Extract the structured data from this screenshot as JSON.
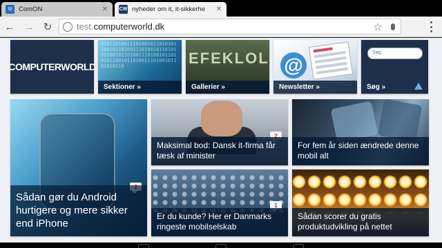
{
  "tabs": [
    {
      "label": "ComON",
      "favicon": "U"
    },
    {
      "label": "nyheder om it, it-sikkerhe",
      "favicon": "CW"
    }
  ],
  "toolbar": {
    "url_scheme": "test.",
    "url_host": "computerworld.dk"
  },
  "nav_tiles": {
    "logo_text": "COMPUTERWORLD",
    "sektioner": "Sektioner »",
    "gallerier": "Gallerier »",
    "gallerier_image_text": "EFEKLOL",
    "newsletter": "Newsletter »",
    "search_placeholder": "Søg",
    "sog": "Søg »"
  },
  "articles": [
    {
      "title": "Sådan gør du Android hurtigere og mere sikker end iPhone",
      "comments": "2"
    },
    {
      "title": "Maksimal bod: Dansk it-firma får tæsk af minister",
      "comments": "2"
    },
    {
      "title": "For fem år siden ændrede denne mobil alt",
      "comments": ""
    },
    {
      "title": "Er du kunde? Her er Danmarks ringeste mobilselskab",
      "comments": "1"
    },
    {
      "title": "Sådan scorer du gratis produktudvikling på nettet",
      "comments": ""
    }
  ],
  "colors": {
    "brand_navy": "#1d2f4a",
    "comment_red": "#c0262c"
  }
}
